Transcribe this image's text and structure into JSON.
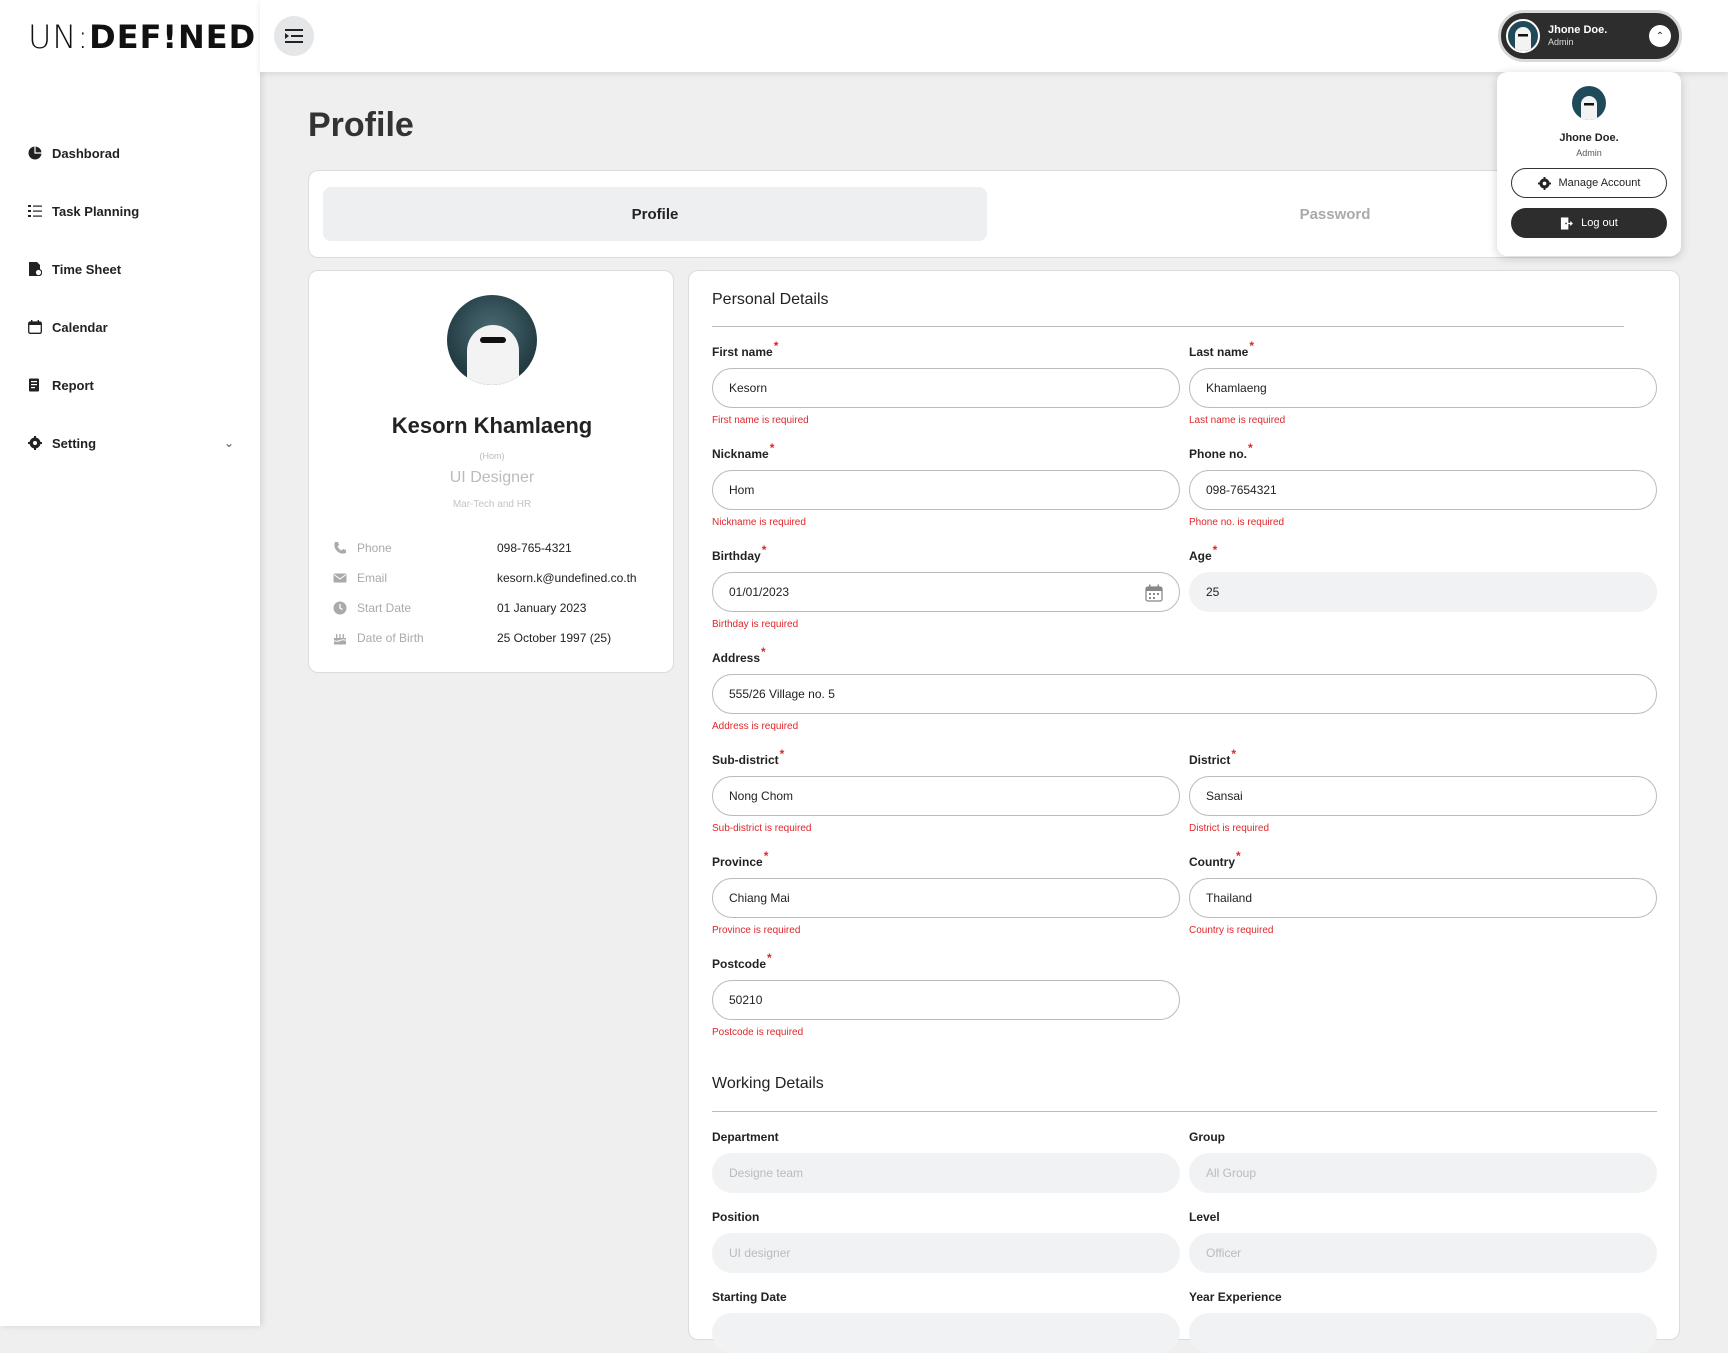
{
  "brand": {
    "logo_left": "UN:",
    "logo_right": "DEF!NED"
  },
  "sidebar": {
    "items": [
      {
        "label": "Dashborad",
        "icon": "pie-chart-icon"
      },
      {
        "label": "Task Planning",
        "icon": "checklist-icon"
      },
      {
        "label": "Time Sheet",
        "icon": "timesheet-icon"
      },
      {
        "label": "Calendar",
        "icon": "calendar-icon"
      },
      {
        "label": "Report",
        "icon": "report-icon"
      },
      {
        "label": "Setting",
        "icon": "gear-icon"
      }
    ]
  },
  "user": {
    "name": "Jhone Doe.",
    "role": "Admin"
  },
  "dropdown": {
    "name": "Jhone Doe.",
    "role": "Admin",
    "manage_label": "Manage Account",
    "logout_label": "Log out"
  },
  "page": {
    "title": "Profile"
  },
  "tabs": [
    {
      "label": "Profile",
      "active": true
    },
    {
      "label": "Password",
      "active": false
    }
  ],
  "profile": {
    "name": "Kesorn Khamlaeng",
    "nickname": "(Hom)",
    "position": "UI Designer",
    "department": "Mar-Tech and HR",
    "info": [
      {
        "label": "Phone",
        "value": "098-765-4321",
        "icon": "phone-icon"
      },
      {
        "label": "Email",
        "value": "kesorn.k@undefined.co.th",
        "icon": "mail-icon"
      },
      {
        "label": "Start Date",
        "value": "01 January 2023",
        "icon": "clock-icon"
      },
      {
        "label": "Date of Birth",
        "value": "25 October 1997 (25)",
        "icon": "cake-icon"
      }
    ]
  },
  "personal": {
    "title": "Personal Details",
    "fields": {
      "first_name": {
        "label": "First name",
        "value": "Kesorn",
        "error": "First name is required"
      },
      "last_name": {
        "label": "Last name",
        "value": "Khamlaeng",
        "error": "Last name is required"
      },
      "nickname": {
        "label": "Nickname",
        "value": "Hom",
        "error": "Nickname is required"
      },
      "phone": {
        "label": "Phone no.",
        "value": "098-7654321",
        "error": "Phone no. is required"
      },
      "birthday": {
        "label": "Birthday",
        "value": "01/01/2023",
        "error": "Birthday is required"
      },
      "age": {
        "label": "Age",
        "value": "25"
      },
      "address": {
        "label": "Address",
        "value": "555/26 Village no. 5",
        "error": "Address is required"
      },
      "subdistrict": {
        "label": "Sub-district",
        "value": "Nong Chom",
        "error": "Sub-district is required"
      },
      "district": {
        "label": "District",
        "value": "Sansai",
        "error": "District is required"
      },
      "province": {
        "label": "Province",
        "value": "Chiang Mai",
        "error": "Province is required"
      },
      "country": {
        "label": "Country",
        "value": "Thailand",
        "error": "Country is required"
      },
      "postcode": {
        "label": "Postcode",
        "value": "50210",
        "error": "Postcode is required"
      }
    }
  },
  "working": {
    "title": "Working Details",
    "fields": {
      "department": {
        "label": "Department",
        "placeholder": "Designe team"
      },
      "group": {
        "label": "Group",
        "placeholder": "All Group"
      },
      "position": {
        "label": "Position",
        "placeholder": "UI designer"
      },
      "level": {
        "label": "Level",
        "placeholder": "Officer"
      },
      "starting_date": {
        "label": "Starting Date"
      },
      "year_experience": {
        "label": "Year Experience"
      }
    }
  },
  "colors": {
    "error": "#e0262a",
    "dark": "#2d2d2d"
  }
}
